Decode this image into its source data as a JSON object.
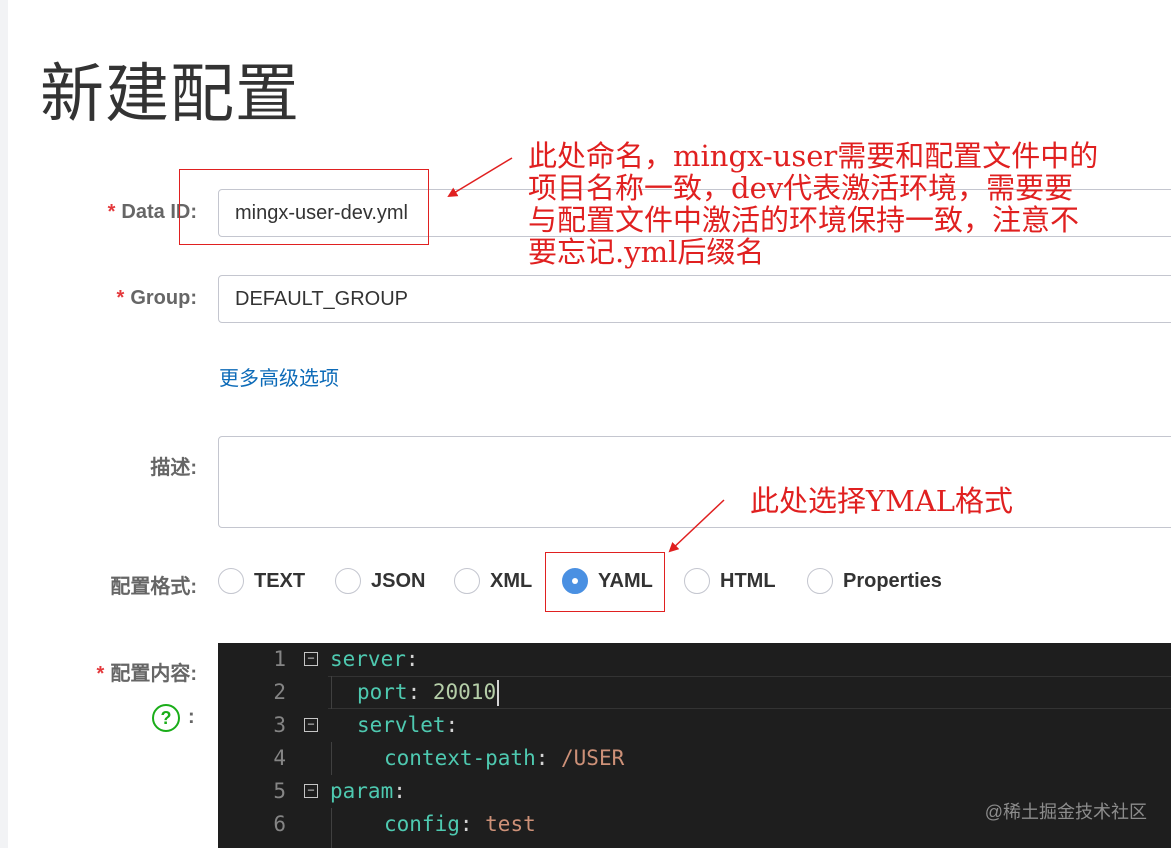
{
  "page": {
    "title": "新建配置"
  },
  "form": {
    "data_id": {
      "required_mark": "*",
      "label": "Data ID:",
      "value": "mingx-user-dev.yml"
    },
    "group": {
      "required_mark": "*",
      "label": "Group:",
      "value": "DEFAULT_GROUP"
    },
    "more_options_link": "更多高级选项",
    "description": {
      "label": "描述:",
      "value": ""
    },
    "format": {
      "label": "配置格式:",
      "selected": "YAML",
      "options": [
        {
          "label": "TEXT",
          "checked": false
        },
        {
          "label": "JSON",
          "checked": false
        },
        {
          "label": "XML",
          "checked": false
        },
        {
          "label": "YAML",
          "checked": true
        },
        {
          "label": "HTML",
          "checked": false
        },
        {
          "label": "Properties",
          "checked": false
        }
      ]
    },
    "content": {
      "required_mark": "*",
      "label": "配置内容:",
      "help_icon": "question-circle-icon",
      "help_glyph": "?",
      "help_colon": ":"
    }
  },
  "editor": {
    "lines": [
      {
        "no": "1",
        "key": "server",
        "sep": ":",
        "value": "",
        "fold": true
      },
      {
        "no": "2",
        "key": "port",
        "sep": ": ",
        "value": "20010",
        "fold": false
      },
      {
        "no": "3",
        "key": "servlet",
        "sep": ":",
        "value": "",
        "fold": true
      },
      {
        "no": "4",
        "key": "context-path",
        "sep": ": ",
        "value": "/USER",
        "fold": false
      },
      {
        "no": "5",
        "key": "param",
        "sep": ":",
        "value": "",
        "fold": true
      },
      {
        "no": "6",
        "key": "config",
        "sep": ": ",
        "value": "test",
        "fold": false
      }
    ],
    "fold_glyph": "−"
  },
  "annotations": {
    "data_id_note": [
      "此处命名，mingx-user需要和配置文件中的",
      "项目名称一致，dev代表激活环境，需要要",
      "与配置文件中激活的环境保持一致，注意不",
      "要忘记.yml后缀名"
    ],
    "format_note": "此处选择YMAL格式",
    "color": "#e02020"
  },
  "watermark": "@稀土掘金技术社区",
  "colors": {
    "required": "#e4393c",
    "link": "#0d6bb8",
    "radio_checked": "#4a90e2",
    "help_icon": "#1aad19",
    "editor_bg": "#1e1e1e"
  }
}
